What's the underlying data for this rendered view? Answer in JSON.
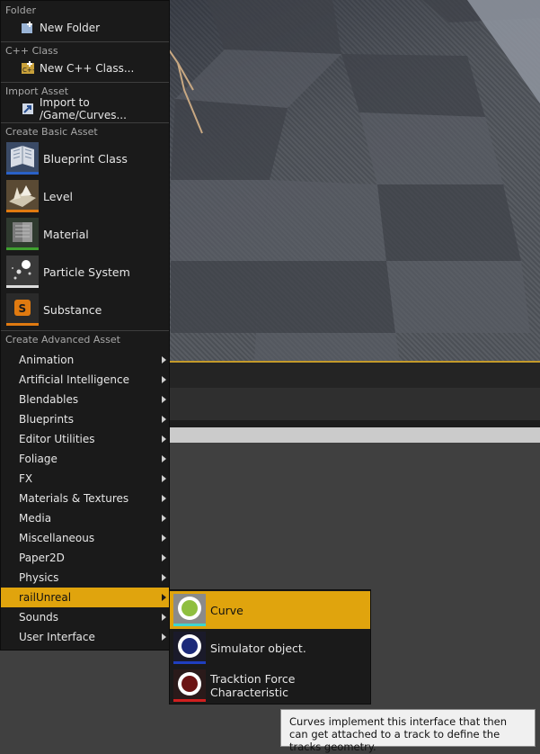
{
  "menu": {
    "folder_section": "Folder",
    "new_folder": "New Folder",
    "cpp_section": "C++ Class",
    "new_cpp": "New C++ Class...",
    "import_section": "Import Asset",
    "import_to": "Import to /Game/Curves...",
    "basic_section": "Create Basic Asset",
    "basic_items": [
      {
        "label": "Blueprint Class",
        "icon": "blueprint-class-icon",
        "color": "#2a61c7"
      },
      {
        "label": "Level",
        "icon": "level-icon",
        "color": "#e07a10"
      },
      {
        "label": "Material",
        "icon": "material-icon",
        "color": "#3fa02f"
      },
      {
        "label": "Particle System",
        "icon": "particle-system-icon",
        "color": "#dcdcdc"
      },
      {
        "label": "Substance",
        "icon": "substance-icon",
        "color": "#e07a10"
      }
    ],
    "advanced_section": "Create Advanced Asset",
    "advanced_items": [
      "Animation",
      "Artificial Intelligence",
      "Blendables",
      "Blueprints",
      "Editor Utilities",
      "Foliage",
      "FX",
      "Materials & Textures",
      "Media",
      "Miscellaneous",
      "Paper2D",
      "Physics",
      "railUnreal",
      "Sounds",
      "User Interface"
    ],
    "selected_advanced": "railUnreal"
  },
  "submenu": {
    "items": [
      {
        "label": "Curve",
        "icon": "curve-icon",
        "fill": "#8fbf3f",
        "color": "#3fd6d0"
      },
      {
        "label": "Simulator object.",
        "icon": "simulator-object-icon",
        "fill": "#1c2a7a",
        "color": "#1f3fbf"
      },
      {
        "label": "Tracktion Force Characteristic",
        "icon": "tracktion-force-icon",
        "fill": "#6b1414",
        "color": "#d11f1f"
      }
    ],
    "selected": "Curve"
  },
  "tooltip": {
    "text": "Curves implement this interface that then can get attached to a track to define the tracks geometry."
  },
  "colors": {
    "accent": "#e0a40d",
    "menu_bg": "#1a1a1a"
  }
}
